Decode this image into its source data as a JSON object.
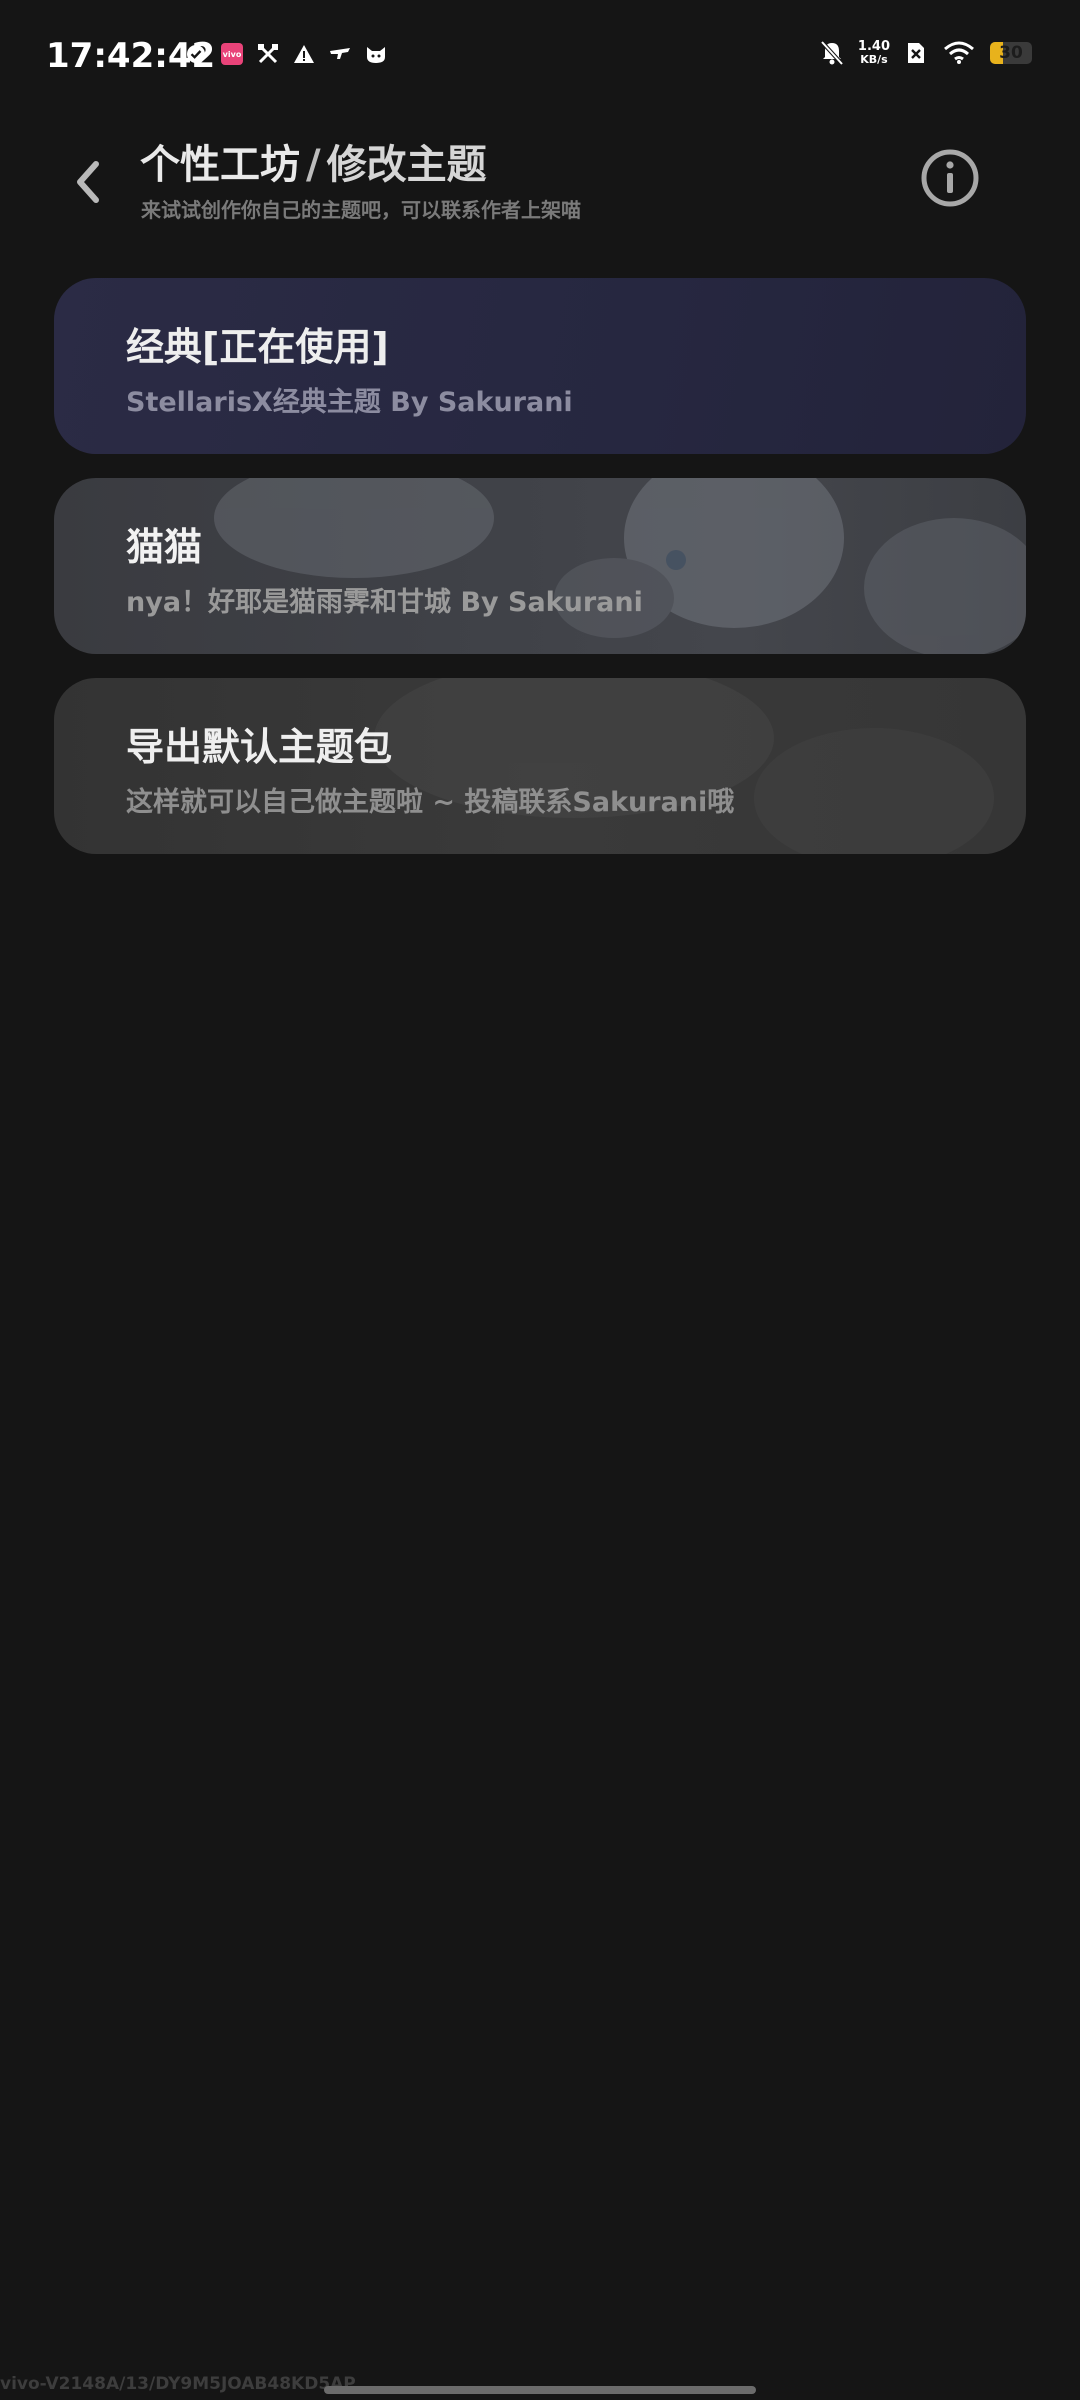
{
  "status_bar": {
    "time": "17:42:42",
    "left_icons": [
      "check-circle-icon",
      "vivo-app-icon",
      "tools-icon",
      "warning-icon",
      "drone-icon",
      "cat-icon"
    ],
    "vivo_badge_text": "vivo",
    "net_speed_value": "1.40",
    "net_speed_unit": "KB/s",
    "battery_level": "30",
    "battery_fraction": 0.3,
    "battery_color": "#e8b21c"
  },
  "header": {
    "title": "个性工坊",
    "separator": "/",
    "title_sub": "修改主题",
    "subtitle": "来试试创作你自己的主题吧，可以联系作者上架喵"
  },
  "themes": [
    {
      "title": "经典[正在使用]",
      "desc": "StellarisX经典主题 By Sakurani"
    },
    {
      "title": "猫猫",
      "desc": "nya！好耶是猫雨霁和甘城 By Sakurani"
    },
    {
      "title": "导出默认主题包",
      "desc": "这样就可以自己做主题啦 ~ 投稿联系Sakurani哦"
    }
  ],
  "footer": {
    "device_id": "vivo-V2148A/13/DY9M5JOAB48KD5AP"
  },
  "colors": {
    "background": "#151515",
    "card_active": "#2b2b45",
    "card_default": "#3a3a3a"
  }
}
